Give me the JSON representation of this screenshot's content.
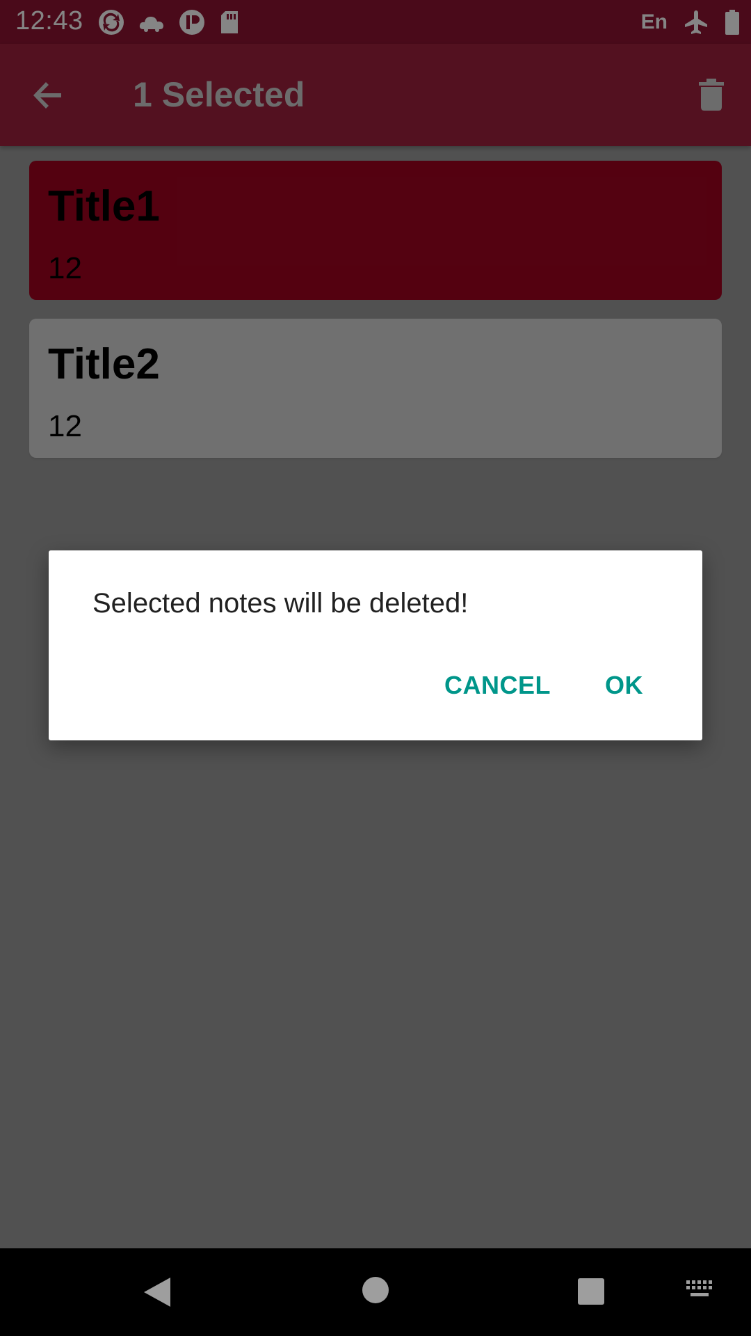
{
  "status_bar": {
    "time": "12:43",
    "language": "En",
    "icons_left": [
      "sync-icon",
      "weather-icon",
      "app-icon",
      "sd-card-icon"
    ],
    "icons_right": [
      "airplane-icon",
      "battery-icon"
    ]
  },
  "app_bar": {
    "title": "1 Selected",
    "back_icon": "back-arrow-icon",
    "action_icon": "trash-icon",
    "color": "#a0213f"
  },
  "notes": [
    {
      "title": "Title1",
      "body": "12",
      "selected": true
    },
    {
      "title": "Title2",
      "body": "12",
      "selected": false
    }
  ],
  "dialog": {
    "message": "Selected notes will be deleted!",
    "cancel_label": "CANCEL",
    "ok_label": "OK",
    "accent_color": "#00968a"
  },
  "nav_bar": {
    "buttons": [
      "back-triangle-icon",
      "home-circle-icon",
      "recents-square-icon",
      "keyboard-icon"
    ]
  }
}
